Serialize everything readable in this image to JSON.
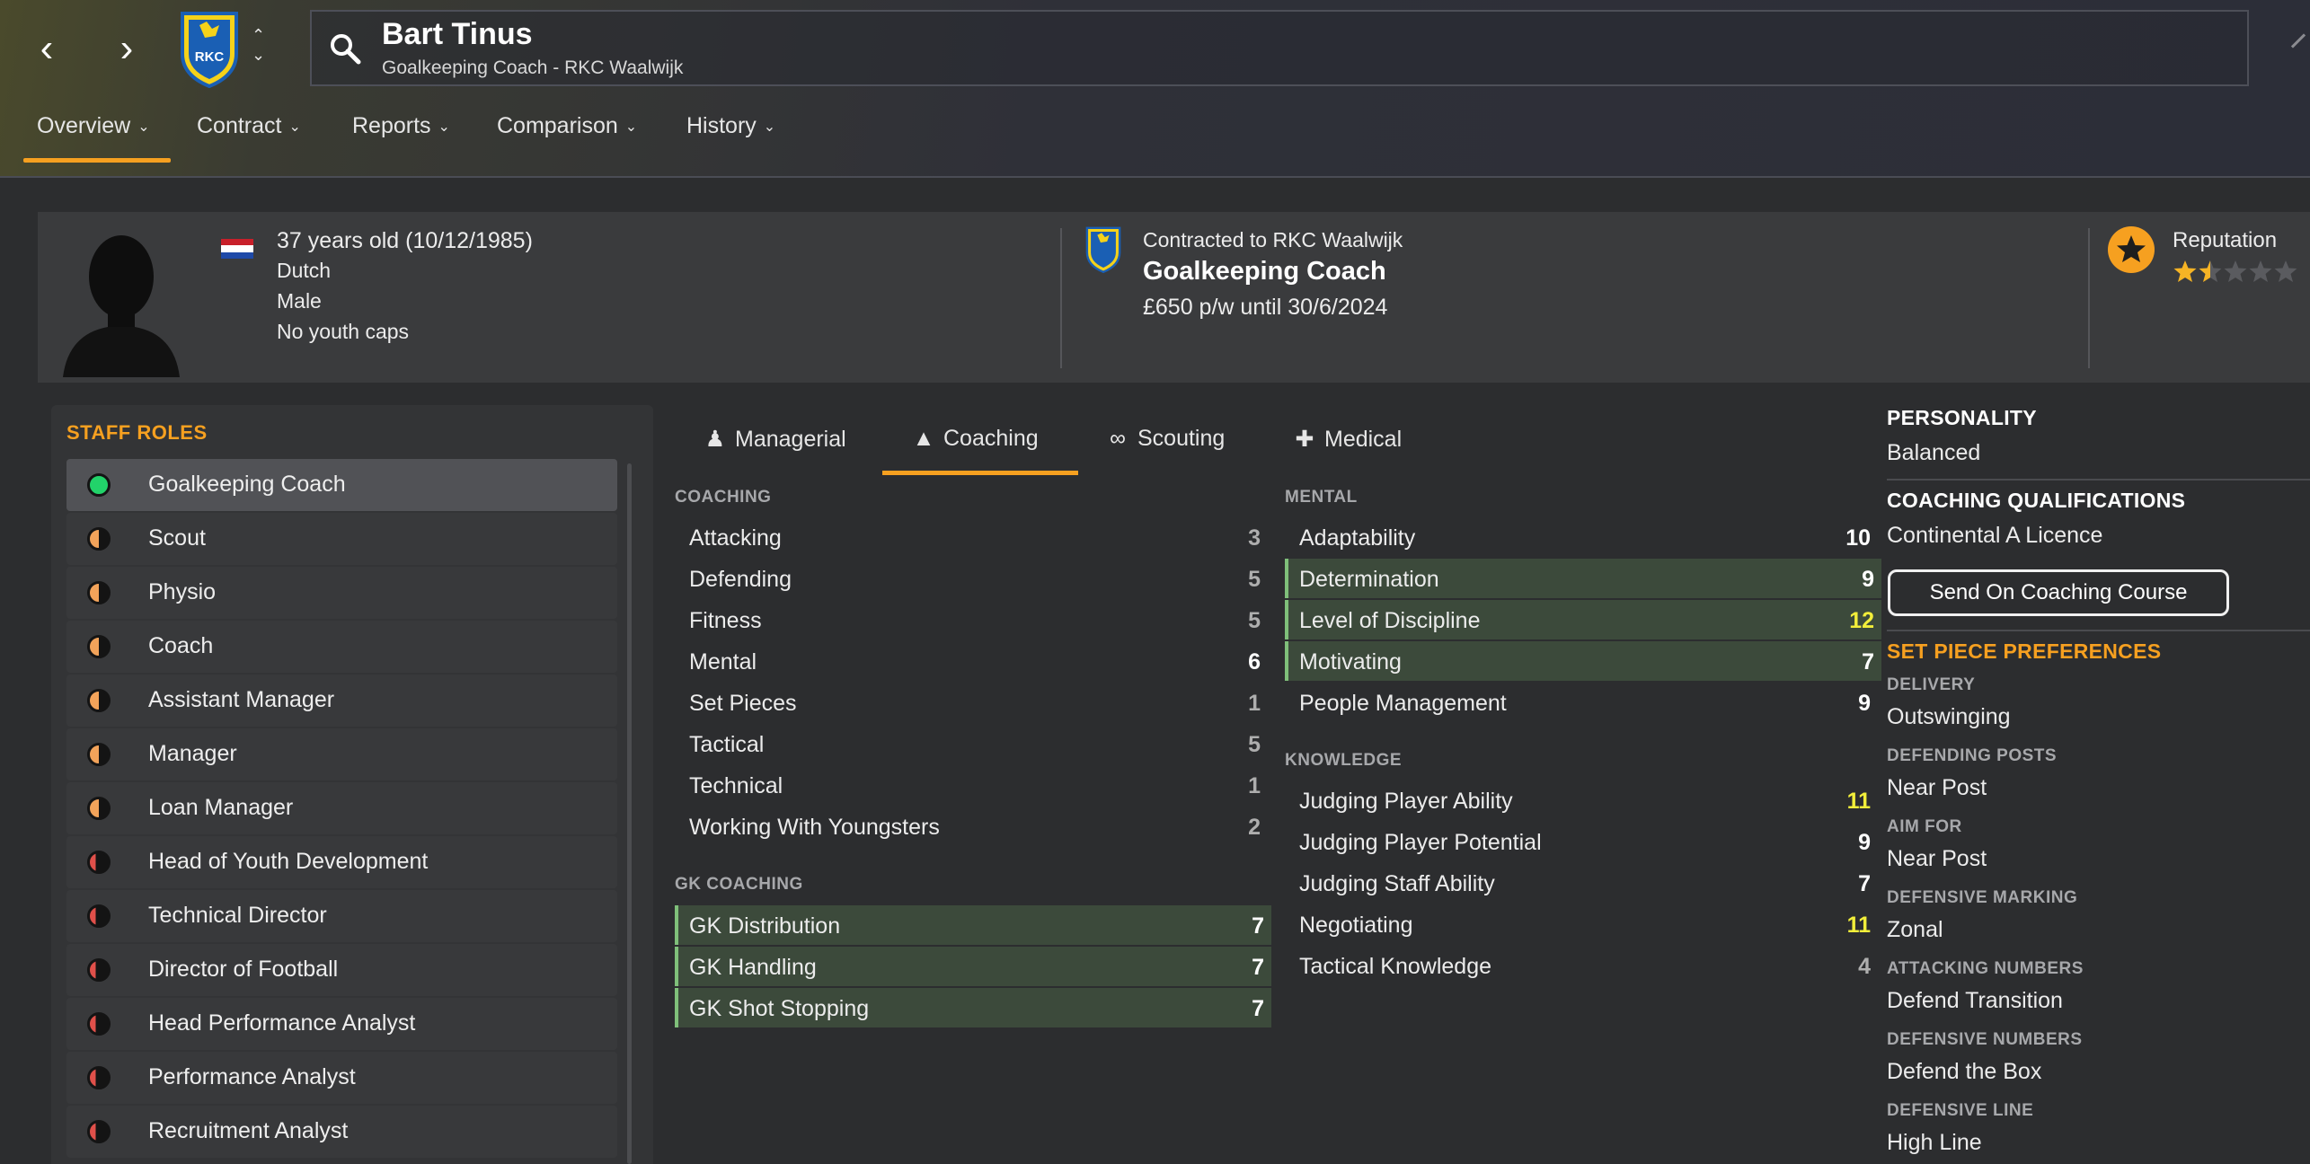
{
  "header": {
    "name": "Bart Tinus",
    "subtitle": "Goalkeeping Coach - RKC Waalwijk",
    "badge_text": "RKC"
  },
  "tabs": [
    {
      "label": "Overview"
    },
    {
      "label": "Contract"
    },
    {
      "label": "Reports"
    },
    {
      "label": "Comparison"
    },
    {
      "label": "History"
    }
  ],
  "profile": {
    "age": "37 years old (10/12/1985)",
    "nationality": "Dutch",
    "gender": "Male",
    "caps": "No youth caps",
    "contract_line": "Contracted to RKC Waalwijk",
    "job": "Goalkeeping Coach",
    "wage": "£650 p/w until 30/6/2024",
    "reputation_label": "Reputation",
    "reputation_stars": 1.5
  },
  "staff_roles": {
    "title": "STAFF ROLES",
    "items": [
      {
        "label": "Goalkeeping Coach",
        "color": "#22d36a",
        "level": "full"
      },
      {
        "label": "Scout",
        "color": "#f2a35a",
        "level": "half"
      },
      {
        "label": "Physio",
        "color": "#f2a35a",
        "level": "half"
      },
      {
        "label": "Coach",
        "color": "#f2a35a",
        "level": "half"
      },
      {
        "label": "Assistant Manager",
        "color": "#f2a35a",
        "level": "half"
      },
      {
        "label": "Manager",
        "color": "#f2a35a",
        "level": "half"
      },
      {
        "label": "Loan Manager",
        "color": "#f2a35a",
        "level": "half"
      },
      {
        "label": "Head of Youth Development",
        "color": "#e0504a",
        "level": "low"
      },
      {
        "label": "Technical Director",
        "color": "#e0504a",
        "level": "low"
      },
      {
        "label": "Director of Football",
        "color": "#e0504a",
        "level": "low"
      },
      {
        "label": "Head Performance Analyst",
        "color": "#e0504a",
        "level": "low"
      },
      {
        "label": "Performance Analyst",
        "color": "#e0504a",
        "level": "low"
      },
      {
        "label": "Recruitment Analyst",
        "color": "#e0504a",
        "level": "low"
      }
    ]
  },
  "attr_tabs": [
    {
      "label": "Managerial"
    },
    {
      "label": "Coaching"
    },
    {
      "label": "Scouting"
    },
    {
      "label": "Medical"
    }
  ],
  "coaching": {
    "title": "COACHING",
    "rows": [
      {
        "label": "Attacking",
        "value": "3"
      },
      {
        "label": "Defending",
        "value": "5"
      },
      {
        "label": "Fitness",
        "value": "5"
      },
      {
        "label": "Mental",
        "value": "6"
      },
      {
        "label": "Set Pieces",
        "value": "1"
      },
      {
        "label": "Tactical",
        "value": "5"
      },
      {
        "label": "Technical",
        "value": "1"
      },
      {
        "label": "Working With Youngsters",
        "value": "2"
      }
    ]
  },
  "gk_coaching": {
    "title": "GK COACHING",
    "rows": [
      {
        "label": "GK Distribution",
        "value": "7"
      },
      {
        "label": "GK Handling",
        "value": "7"
      },
      {
        "label": "GK Shot Stopping",
        "value": "7"
      }
    ]
  },
  "mental": {
    "title": "MENTAL",
    "rows": [
      {
        "label": "Adaptability",
        "value": "10"
      },
      {
        "label": "Determination",
        "value": "9"
      },
      {
        "label": "Level of Discipline",
        "value": "12"
      },
      {
        "label": "Motivating",
        "value": "7"
      },
      {
        "label": "People Management",
        "value": "9"
      }
    ]
  },
  "knowledge": {
    "title": "KNOWLEDGE",
    "rows": [
      {
        "label": "Judging Player Ability",
        "value": "11"
      },
      {
        "label": "Judging Player Potential",
        "value": "9"
      },
      {
        "label": "Judging Staff Ability",
        "value": "7"
      },
      {
        "label": "Negotiating",
        "value": "11"
      },
      {
        "label": "Tactical Knowledge",
        "value": "4"
      }
    ]
  },
  "right": {
    "personality_title": "PERSONALITY",
    "personality": "Balanced",
    "qual_title": "COACHING QUALIFICATIONS",
    "qualification": "Continental A Licence",
    "course_button": "Send On Coaching Course",
    "setpiece_title": "SET PIECE PREFERENCES",
    "prefs": [
      {
        "label": "DELIVERY",
        "value": "Outswinging"
      },
      {
        "label": "DEFENDING POSTS",
        "value": "Near Post"
      },
      {
        "label": "AIM FOR",
        "value": "Near Post"
      },
      {
        "label": "DEFENSIVE MARKING",
        "value": "Zonal"
      },
      {
        "label": "ATTACKING NUMBERS",
        "value": "Defend Transition"
      },
      {
        "label": "DEFENSIVE NUMBERS",
        "value": "Defend the Box"
      },
      {
        "label": "DEFENSIVE LINE",
        "value": "High Line"
      }
    ]
  },
  "colors": {
    "accent": "#f6a020",
    "highlight_value": "#f2ee3a",
    "hl_row": "#3c4a3b"
  }
}
